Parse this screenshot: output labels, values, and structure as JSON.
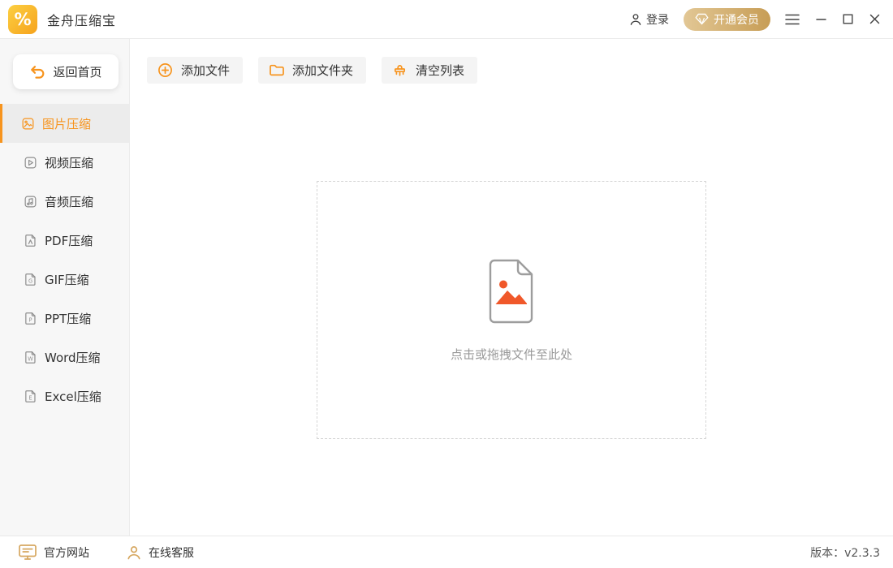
{
  "window": {
    "app_title": "金舟压缩宝",
    "login_label": "登录",
    "member_label": "开通会员"
  },
  "sidebar": {
    "back_label": "返回首页",
    "items": [
      {
        "label": "图片压缩",
        "icon": "image-icon",
        "active": true
      },
      {
        "label": "视频压缩",
        "icon": "video-icon",
        "active": false
      },
      {
        "label": "音频压缩",
        "icon": "audio-icon",
        "active": false
      },
      {
        "label": "PDF压缩",
        "icon": "pdf-file-icon",
        "active": false
      },
      {
        "label": "GIF压缩",
        "icon": "gif-file-icon",
        "active": false
      },
      {
        "label": "PPT压缩",
        "icon": "ppt-file-icon",
        "active": false
      },
      {
        "label": "Word压缩",
        "icon": "word-file-icon",
        "active": false
      },
      {
        "label": "Excel压缩",
        "icon": "excel-file-icon",
        "active": false
      }
    ],
    "icon_letters": {
      "gif": "G",
      "ppt": "P",
      "word": "W",
      "excel": "E"
    }
  },
  "toolbar": {
    "add_files_label": "添加文件",
    "add_folder_label": "添加文件夹",
    "clear_list_label": "清空列表"
  },
  "dropzone": {
    "hint": "点击或拖拽文件至此处"
  },
  "footer": {
    "website_label": "官方网站",
    "support_label": "在线客服",
    "version_label": "版本：v2.3.3"
  },
  "branding": {
    "logo_glyph": "%"
  },
  "colors": {
    "accent_orange": "#F7941E",
    "drop_glyph_orange": "#F0582A",
    "member_gold_start": "#E2C795",
    "member_gold_end": "#C79D55",
    "gold_icon": "#D6A760",
    "sidebar_bg": "#F7F7F7",
    "active_item_bg": "#ECECEC"
  }
}
